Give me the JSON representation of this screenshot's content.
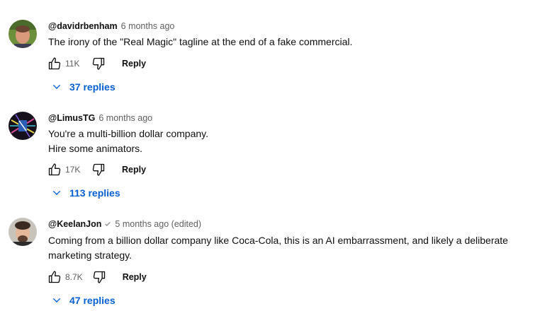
{
  "comments": [
    {
      "author": "@davidrbenham",
      "time": "6 months ago",
      "verified": false,
      "lines": [
        "The irony of the \"Real Magic\" tagline at the end of a fake commercial."
      ],
      "likes": "11K",
      "reply_label": "Reply",
      "replies_label": "37 replies"
    },
    {
      "author": "@LimusTG",
      "time": "6 months ago",
      "verified": false,
      "lines": [
        "You're a multi-billion dollar company.",
        "Hire some animators."
      ],
      "likes": "17K",
      "reply_label": "Reply",
      "replies_label": "113 replies"
    },
    {
      "author": "@KeelanJon",
      "time": "5 months ago (edited)",
      "verified": true,
      "lines": [
        "Coming from a billion dollar company like Coca-Cola, this is an AI embarrassment, and likely a deliberate",
        "marketing strategy."
      ],
      "likes": "8.7K",
      "reply_label": "Reply",
      "replies_label": "47 replies"
    }
  ],
  "icons": {
    "like": "thumbs-up-icon",
    "dislike": "thumbs-down-icon",
    "expand": "chevron-down-icon",
    "verified": "checkmark-icon"
  },
  "colors": {
    "link_blue": "#065fd4",
    "meta_gray": "#606060",
    "text": "#0f0f0f"
  }
}
